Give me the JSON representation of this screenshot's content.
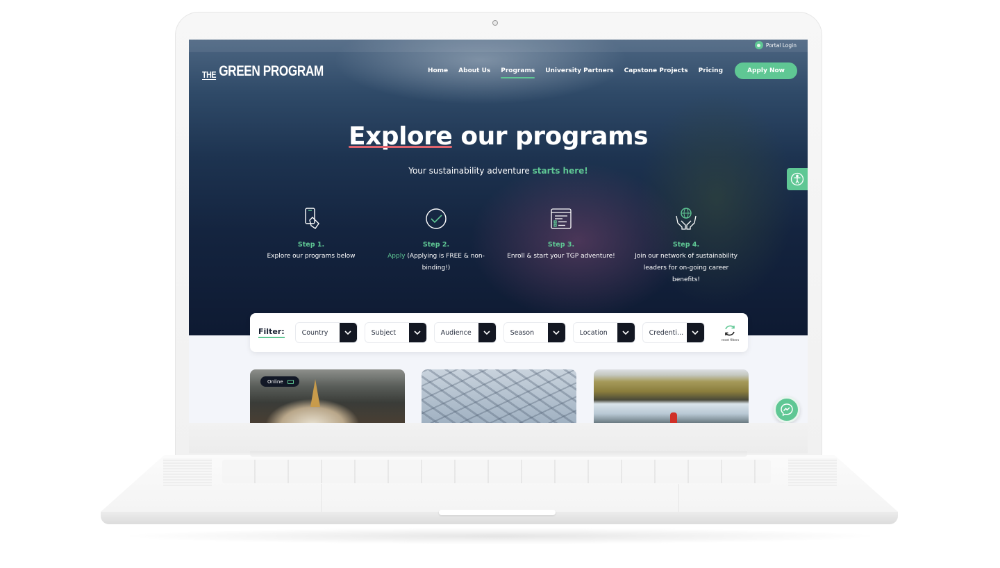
{
  "site": {
    "logo_prefix": "THE",
    "logo_main": "GREEN PROGRAM",
    "portal_login": "Portal Login"
  },
  "nav": {
    "items": [
      {
        "label": "Home",
        "active": false
      },
      {
        "label": "About Us",
        "active": false
      },
      {
        "label": "Programs",
        "active": true
      },
      {
        "label": "University Partners",
        "active": false
      },
      {
        "label": "Capstone Projects",
        "active": false
      },
      {
        "label": "Pricing",
        "active": false
      }
    ],
    "apply_button": "Apply Now"
  },
  "hero": {
    "title_underlined": "Explore",
    "title_rest": " our programs",
    "subtitle_plain": "Your sustainability adventure ",
    "subtitle_highlight": "starts here!"
  },
  "steps": [
    {
      "icon": "phone-hand-icon",
      "title": "Step 1.",
      "highlight": "",
      "text": "Explore our programs below"
    },
    {
      "icon": "check-circle-icon",
      "title": "Step 2.",
      "highlight": "Apply",
      "text": " (Applying is FREE & non-binding!)"
    },
    {
      "icon": "checklist-window-icon",
      "title": "Step 3.",
      "highlight": "",
      "text": "Enroll & start your TGP adventure!"
    },
    {
      "icon": "globe-hands-icon",
      "title": "Step 4.",
      "highlight": "",
      "text": "Join our network of sustainability leaders for on-going career benefits!"
    }
  ],
  "filter": {
    "label": "Filter:",
    "dropdowns": [
      "Country",
      "Subject",
      "Audience",
      "Season",
      "Location",
      "Credenti..."
    ],
    "reset_label": "reset filters"
  },
  "cards": [
    {
      "badge": "Online",
      "image": "stupa-city-aerial"
    },
    {
      "badge": "",
      "image": "glacier-hikers"
    },
    {
      "badge": "",
      "image": "waterfall-person"
    }
  ],
  "colors": {
    "accent_green": "#5fc794",
    "underline_red": "#e0646e",
    "hero_dark": "#0e1a32",
    "dropdown_button": "#131722"
  }
}
